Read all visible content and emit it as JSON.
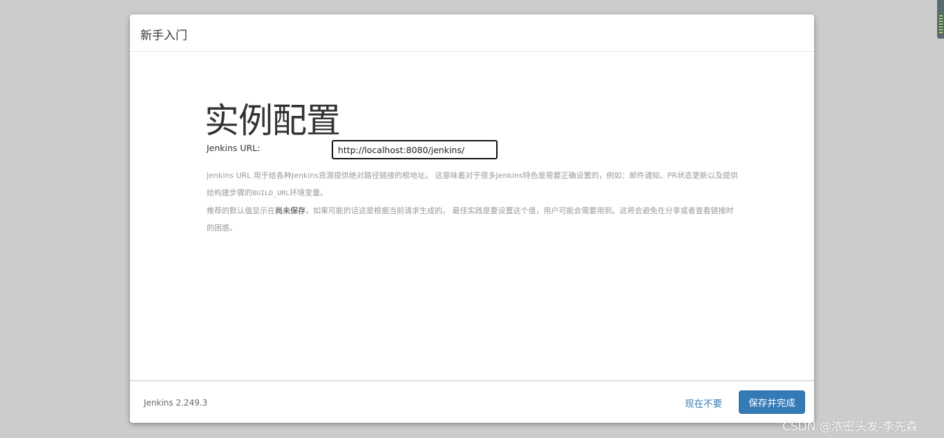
{
  "dialog": {
    "title": "新手入门"
  },
  "main": {
    "heading": "实例配置",
    "url_label": "Jenkins URL:",
    "url_value": "http://localhost:8080/jenkins/",
    "help": {
      "line1_part1": "Jenkins URL 用于给各种Jenkins资源提供绝对路径链接的根地址。 这意味着对于很多Jenkins特色是需要正确设置的，例如：邮件通知、PR状态更新以及提供给构建步骤的",
      "line1_code": "BUILD_URL",
      "line1_part2": "环境变量。",
      "line2_part1": "推荐的默认值显示在",
      "line2_bold": "尚未保存",
      "line2_part2": "，如果可能的话这是根据当前请求生成的。 最佳实践是要设置这个值，用户可能会需要用到。这将会避免在分享或者查看链接时的困惑。"
    }
  },
  "footer": {
    "version": "Jenkins 2.249.3",
    "skip_label": "现在不要",
    "save_label": "保存并完成"
  },
  "watermark": "CSDN @浓密头发-李先森",
  "colors": {
    "primary": "#337ab7",
    "backdrop": "#cccccc"
  }
}
